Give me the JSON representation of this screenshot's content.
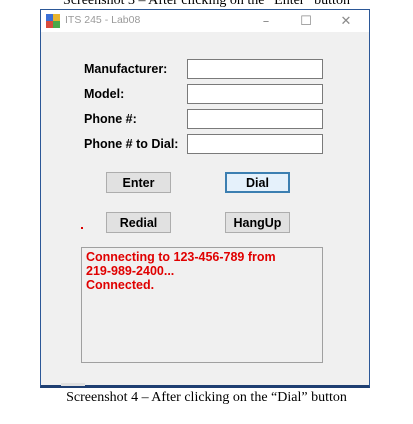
{
  "captions": {
    "top": "Screenshot 3 – After clicking on the “Enter” button",
    "bottom": "Screenshot 4 – After clicking on the “Dial” button"
  },
  "window": {
    "title": "ITS 245 - Lab08",
    "minimize_glyph": "–",
    "maximize_glyph": "☐",
    "close_glyph": "✕"
  },
  "form": {
    "manufacturer_label": "Manufacturer:",
    "model_label": "Model:",
    "phone_label": "Phone #:",
    "dial_label": "Phone # to Dial:",
    "manufacturer_value": "",
    "model_value": "",
    "phone_value": "",
    "dial_value": ""
  },
  "buttons": {
    "enter": "Enter",
    "dial": "Dial",
    "redial": "Redial",
    "hangup": "HangUp"
  },
  "output": {
    "lines": [
      "Connecting to 123-456-789 from",
      "219-989-2400...",
      "Connected."
    ]
  },
  "colors": {
    "output_text": "#e00000",
    "focus_border": "#3c7fb1",
    "window_border": "#2b5797"
  }
}
